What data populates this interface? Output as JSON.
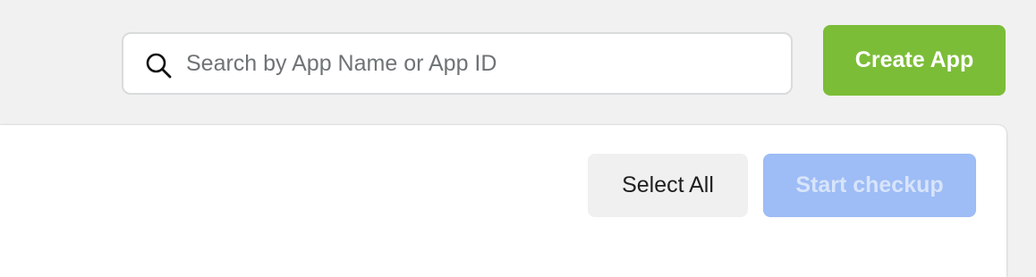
{
  "search": {
    "placeholder": "Search by App Name or App ID",
    "value": "",
    "icon": "search-icon"
  },
  "header": {
    "create_app_label": "Create App"
  },
  "panel": {
    "select_all_label": "Select All",
    "start_checkup_label": "Start checkup",
    "start_checkup_disabled": true
  },
  "colors": {
    "background": "#f1f1f1",
    "create_app": "#7cbd38",
    "start_checkup_disabled": "#9ebcf5",
    "select_all": "#f0f0f0"
  }
}
